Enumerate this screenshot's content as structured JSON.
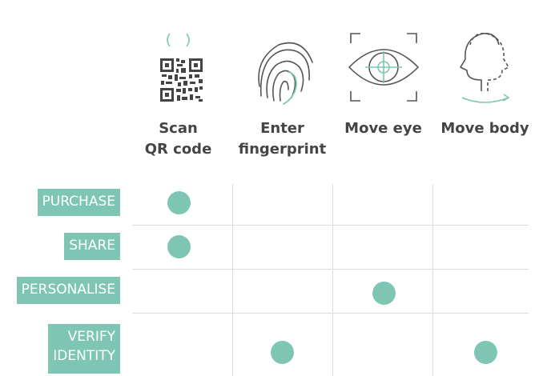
{
  "columns": [
    {
      "label": "Scan\nQR code",
      "icon": "qr-code-icon"
    },
    {
      "label": "Enter\nfingerprint",
      "icon": "fingerprint-icon"
    },
    {
      "label": "Move eye",
      "icon": "eye-scan-icon"
    },
    {
      "label": "Move body",
      "icon": "head-turn-icon"
    }
  ],
  "rows": [
    {
      "label": "PURCHASE",
      "checked": [
        true,
        false,
        false,
        false
      ]
    },
    {
      "label": "SHARE",
      "checked": [
        true,
        false,
        false,
        false
      ]
    },
    {
      "label": "PERSONALISE",
      "checked": [
        false,
        false,
        true,
        false
      ]
    },
    {
      "label": "VERIFY\nIDENTITY",
      "checked": [
        false,
        true,
        false,
        true
      ]
    }
  ],
  "colors": {
    "accent": "#7ec6b3",
    "icon_stroke": "#555555",
    "grid": "#dcdcdc"
  }
}
